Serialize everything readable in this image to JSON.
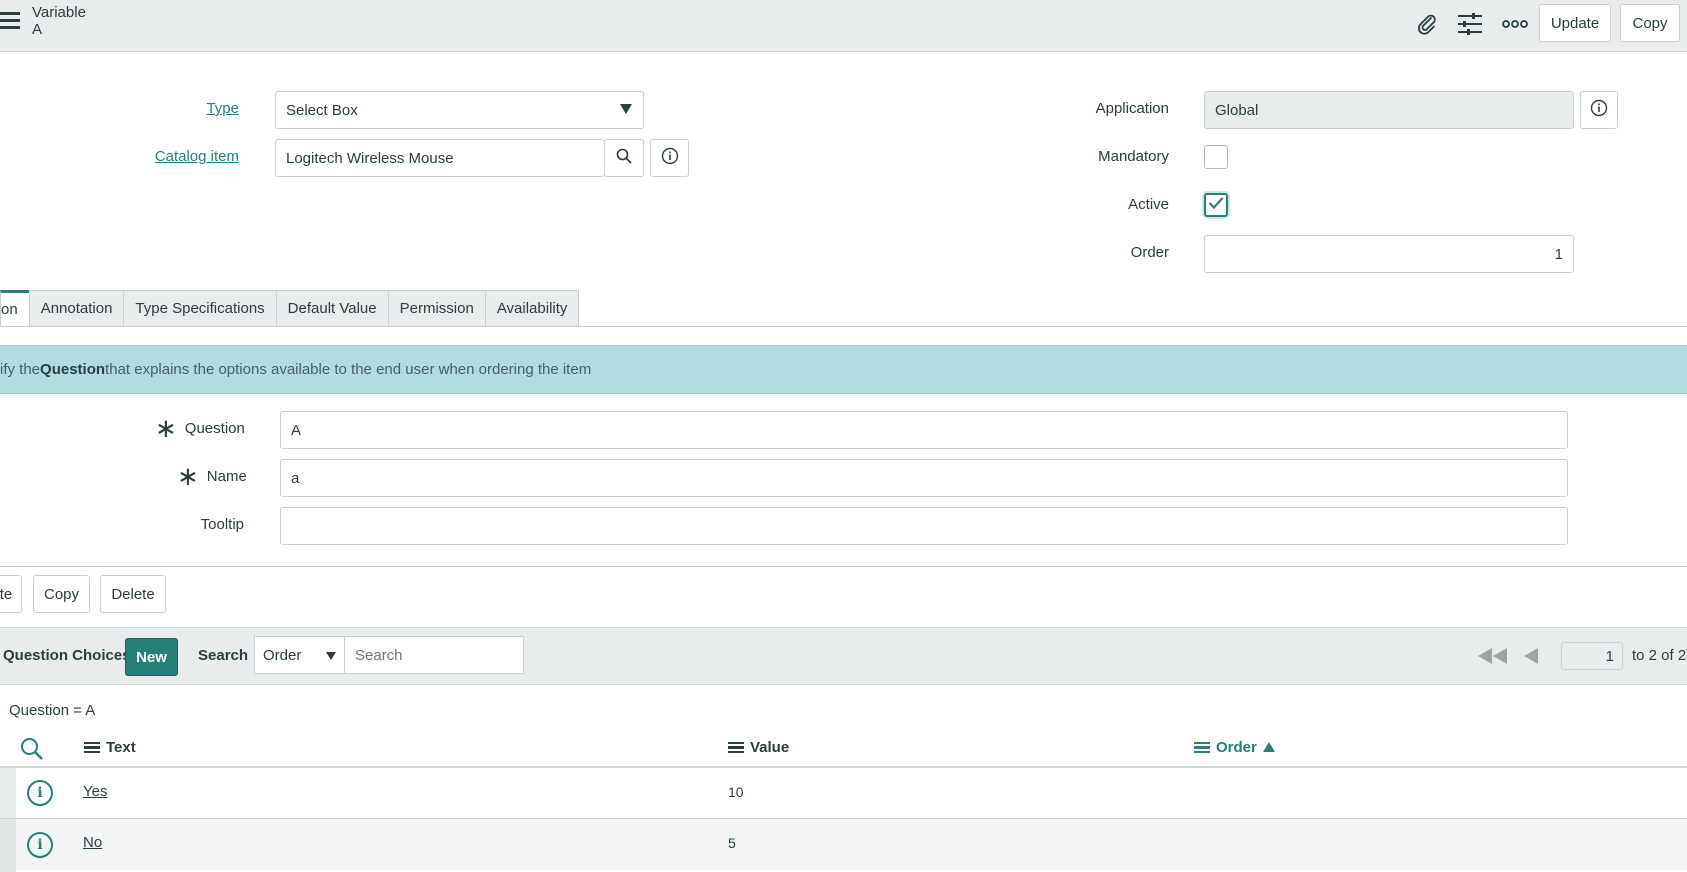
{
  "header": {
    "record_type": "Variable",
    "record_name": "A",
    "update_label": "Update",
    "copy_label": "Copy"
  },
  "form": {
    "type_label": "Type",
    "type_value": "Select Box",
    "catalog_item_label": "Catalog item",
    "catalog_item_value": "Logitech Wireless Mouse",
    "application_label": "Application",
    "application_value": "Global",
    "mandatory_label": "Mandatory",
    "mandatory_checked": false,
    "active_label": "Active",
    "active_checked": true,
    "order_label": "Order",
    "order_value": "1"
  },
  "tabs": [
    {
      "label": "on",
      "active": true
    },
    {
      "label": "Annotation",
      "active": false
    },
    {
      "label": "Type Specifications",
      "active": false
    },
    {
      "label": "Default Value",
      "active": false
    },
    {
      "label": "Permission",
      "active": false
    },
    {
      "label": "Availability",
      "active": false
    }
  ],
  "banner": {
    "prefix": "ify the ",
    "bold": "Question",
    "suffix": " that explains the options available to the end user when ordering the item"
  },
  "question_section": {
    "question_label": "Question",
    "question_value": "A",
    "name_label": "Name",
    "name_value": "a",
    "tooltip_label": "Tooltip",
    "tooltip_value": ""
  },
  "form_buttons": {
    "update_partial": "te",
    "copy": "Copy",
    "delete": "Delete"
  },
  "related_list": {
    "title": "Question Choices",
    "new_label": "New",
    "search_label": "Search",
    "search_field": "Order",
    "search_placeholder": "Search",
    "page_value": "1",
    "page_range": "to 2 of 2",
    "filter": "Question = A",
    "columns": {
      "text": "Text",
      "value": "Value",
      "order": "Order"
    },
    "rows": [
      {
        "text": "Yes",
        "value": "10",
        "order": ""
      },
      {
        "text": "No",
        "value": "5",
        "order": ""
      }
    ]
  },
  "colors": {
    "accent": "#278078",
    "banner": "#b3dbe1",
    "header_bg": "#e8eced"
  }
}
